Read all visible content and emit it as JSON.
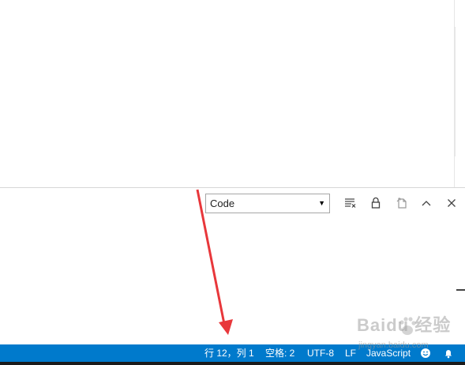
{
  "output_panel": {
    "channel_select": {
      "selected": "Code"
    },
    "toolbar_icons": [
      "clear-output-icon",
      "lock-scroll-icon",
      "open-log-file-icon",
      "maximize-panel-icon",
      "close-panel-icon"
    ]
  },
  "status_bar": {
    "cursor_position": "行 12，列 1",
    "indentation": "空格: 2",
    "encoding": "UTF-8",
    "line_ending": "LF",
    "language": "JavaScript",
    "icons": [
      "feedback-smiley-icon",
      "notifications-bell-icon"
    ]
  },
  "watermark": {
    "brand": "Baidu 经验",
    "site": "jingyan.baidu.com"
  },
  "colors": {
    "status_bar_bg": "#007acc",
    "annotation_arrow": "#e8373b"
  }
}
